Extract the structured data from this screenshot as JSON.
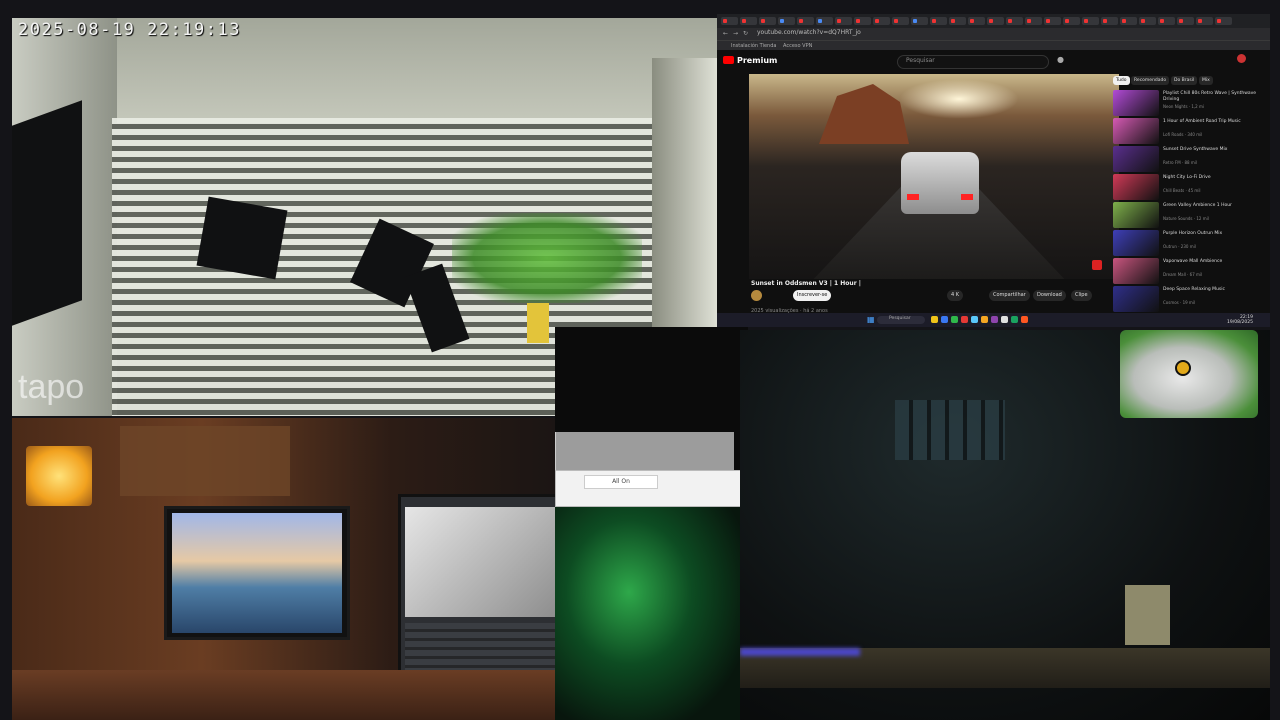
{
  "camera_feed": {
    "timestamp": "2025-08-19  22:19:13",
    "logo": "tapo"
  },
  "browser": {
    "tab_colors": [
      "#e33",
      "#e33",
      "#e33",
      "#4a8af4",
      "#e33",
      "#4a8af4",
      "#e33",
      "#e33",
      "#e33",
      "#e33",
      "#4a8af4",
      "#e33",
      "#e33",
      "#e33",
      "#e33",
      "#e33",
      "#e33",
      "#e33",
      "#e33",
      "#e33",
      "#e33",
      "#e33",
      "#e33",
      "#e33",
      "#e33",
      "#e33",
      "#e33"
    ],
    "address": "youtube.com/watch?v=dQ7HRT_jo",
    "bookmarks": [
      "Instalación Tienda",
      "Acceso VPN"
    ],
    "accent_color": "#ff0000"
  },
  "youtube": {
    "logo": "Premium",
    "search_placeholder": "Pesquisar",
    "video_title": "Sunset in Oddsmen V3 | 1 Hour |",
    "subscribe_label": "Inscrever-se",
    "actions": [
      "4 K",
      "Compartilhar",
      "Download",
      "Clipe"
    ],
    "description": "2025 visualizações · há 2 anos",
    "chips": [
      "Tudo",
      "Recomendado",
      "Do Brasil",
      "Mix"
    ],
    "recommendations": [
      {
        "title": "Playlist Chill 80s Retro Wave | Synthwave Driving",
        "meta": "Neon Nights · 1,2 mi",
        "color": "#b24bd6"
      },
      {
        "title": "1 Hour of Ambient Road Trip Music",
        "meta": "Lofi Roads · 340 mil",
        "color": "#d65ab4"
      },
      {
        "title": "Sunset Drive Synthwave Mix",
        "meta": "Retro FM · 88 mil",
        "color": "#5a2f8e"
      },
      {
        "title": "Night City Lo-Fi Drive",
        "meta": "Chill Beats · 45 mil",
        "color": "#d13a57"
      },
      {
        "title": "Green Valley Ambience 1 Hour",
        "meta": "Nature Sounds · 12 mil",
        "color": "#7fb14b"
      },
      {
        "title": "Purple Horizon Outrun Mix",
        "meta": "Outrun · 230 mil",
        "color": "#3e3fb8"
      },
      {
        "title": "Vaporwave Mall Ambience",
        "meta": "Dream Mall · 67 mil",
        "color": "#c9557f"
      },
      {
        "title": "Deep Space Relaxing Music",
        "meta": "Cosmos · 19 mil",
        "color": "#2f2f8a"
      }
    ]
  },
  "taskbar": {
    "search_label": "Pesquisar",
    "icon_colors": [
      "#f0c419",
      "#3a78f2",
      "#2fb74b",
      "#e53935",
      "#5ac8fa",
      "#f5a623",
      "#8e44ad",
      "#e0e0e0",
      "#1aa260",
      "#ff5722"
    ],
    "time": "22:19",
    "date": "19/08/2025"
  },
  "popup": {
    "button_label": "All On"
  }
}
